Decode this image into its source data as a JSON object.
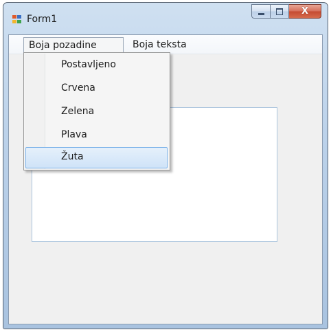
{
  "window": {
    "title": "Form1",
    "icon": "form-app-icon",
    "caption_buttons": {
      "minimize": "minimize-icon",
      "maximize": "maximize-icon",
      "close": "X"
    }
  },
  "menubar": {
    "items": [
      {
        "label": "Boja pozadine",
        "open": true
      },
      {
        "label": "Boja teksta",
        "open": false
      }
    ]
  },
  "dropdown": {
    "items": [
      {
        "label": "Postavljeno",
        "highlighted": false
      },
      {
        "label": "Crvena",
        "highlighted": false
      },
      {
        "label": "Zelena",
        "highlighted": false
      },
      {
        "label": "Plava",
        "highlighted": false
      },
      {
        "label": "Žuta",
        "highlighted": true
      }
    ]
  },
  "textbox": {
    "value": ""
  },
  "colors": {
    "highlight_border": "#7eb4ea",
    "close_button": "#c54a31",
    "titlebar": "#bcd2ea"
  }
}
